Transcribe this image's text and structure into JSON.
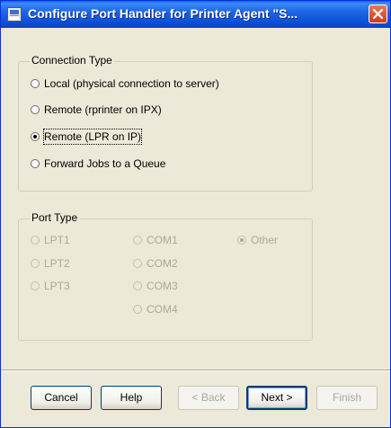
{
  "window": {
    "title": "Configure Port Handler for Printer Agent \"S...",
    "colors": {
      "titlebar": "#0b4fd6",
      "dialog_bg": "#ece9d8",
      "close": "#cf3a18"
    }
  },
  "connection_type": {
    "legend": "Connection Type",
    "options": [
      {
        "label": "Local (physical connection to server)",
        "selected": false
      },
      {
        "label": "Remote (rprinter on IPX)",
        "selected": false
      },
      {
        "label": "Remote (LPR on IP)",
        "selected": true
      },
      {
        "label": "Forward Jobs to a Queue",
        "selected": false
      }
    ]
  },
  "port_type": {
    "legend": "Port Type",
    "options": [
      {
        "label": "LPT1",
        "selected": false
      },
      {
        "label": "LPT2",
        "selected": false
      },
      {
        "label": "LPT3",
        "selected": false
      },
      {
        "label": "COM1",
        "selected": false
      },
      {
        "label": "COM2",
        "selected": false
      },
      {
        "label": "COM3",
        "selected": false
      },
      {
        "label": "COM4",
        "selected": false
      },
      {
        "label": "Other",
        "selected": true
      }
    ]
  },
  "buttons": {
    "cancel": "Cancel",
    "help": "Help",
    "back": "< Back",
    "next": "Next >",
    "finish": "Finish"
  }
}
